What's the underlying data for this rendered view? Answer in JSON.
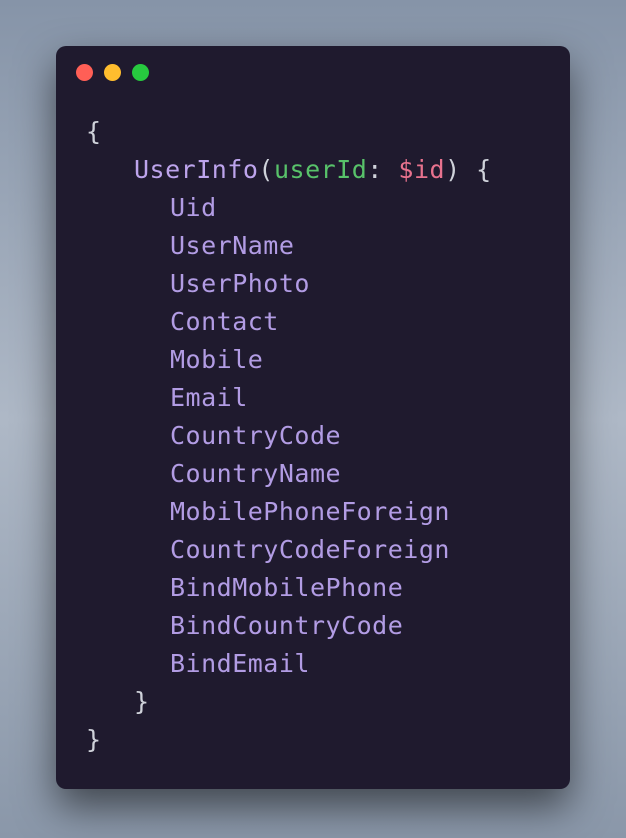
{
  "window": {
    "controls": {
      "close": "close",
      "minimize": "minimize",
      "zoom": "zoom"
    }
  },
  "code": {
    "brace_open": "{",
    "brace_close": "}",
    "type": "UserInfo",
    "paren_open": "(",
    "arg": "userId",
    "colon_sp": ": ",
    "var": "$id",
    "paren_close_brace": ") {",
    "fields": {
      "f1": "Uid",
      "f2": "UserName",
      "f3": "UserPhoto",
      "f4": "Contact",
      "f5": "Mobile",
      "f6": "Email",
      "f7": "CountryCode",
      "f8": "CountryName",
      "f9": "MobilePhoneForeign",
      "f10": "CountryCodeForeign",
      "f11": "BindMobilePhone",
      "f12": "BindCountryCode",
      "f13": "BindEmail"
    }
  }
}
